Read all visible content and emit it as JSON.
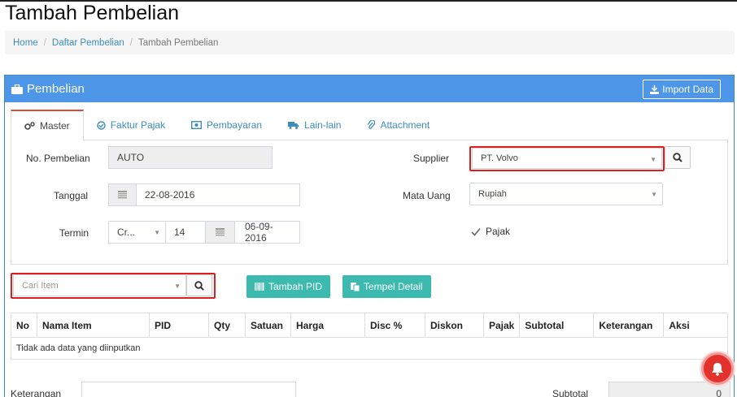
{
  "page": {
    "title": "Tambah Pembelian"
  },
  "breadcrumb": {
    "items": [
      "Home",
      "Daftar Pembelian"
    ],
    "current": "Tambah Pembelian"
  },
  "panel": {
    "title": "Pembelian",
    "import_label": "Import Data"
  },
  "tabs": [
    {
      "label": "Master",
      "icon": "cogs-icon",
      "active": true
    },
    {
      "label": "Faktur Pajak",
      "icon": "check-circle-icon"
    },
    {
      "label": "Pembayaran",
      "icon": "money-icon"
    },
    {
      "label": "Lain-lain",
      "icon": "truck-icon"
    },
    {
      "label": "Attachment",
      "icon": "paperclip-icon"
    }
  ],
  "form": {
    "no_pembelian": {
      "label": "No. Pembelian",
      "value": "AUTO"
    },
    "tanggal": {
      "label": "Tanggal",
      "value": "22-08-2016"
    },
    "termin": {
      "label": "Termin",
      "type_value": "Cr...",
      "days": "14",
      "due_date": "06-09-2016"
    },
    "supplier": {
      "label": "Supplier",
      "value": "PT. Volvo"
    },
    "mata_uang": {
      "label": "Mata Uang",
      "value": "Rupiah"
    },
    "pajak": {
      "label": "Pajak",
      "checked": true
    }
  },
  "item_search": {
    "placeholder": "Cari Item"
  },
  "buttons": {
    "tambah_pid": "Tambah PID",
    "tempel_detail": "Tempel Detail"
  },
  "table": {
    "headers": [
      "No",
      "Nama Item",
      "PID",
      "Qty",
      "Satuan",
      "Harga",
      "Disc %",
      "Diskon",
      "Pajak",
      "Subtotal",
      "Keterangan",
      "Aksi"
    ],
    "empty_text": "Tidak ada data yang diinputkan"
  },
  "footer": {
    "keterangan_label": "Keterangan",
    "subtotal_label": "Subtotal",
    "subtotal_value": "0"
  },
  "colors": {
    "primary": "#3c8dbc",
    "panel_head": "#4d96e8",
    "teal": "#3dbab0",
    "highlight": "#e01e1e",
    "tab_active": "#dd4b39"
  }
}
